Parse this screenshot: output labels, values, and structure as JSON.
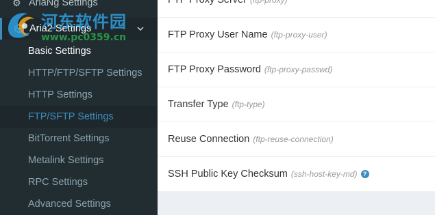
{
  "sidebar": {
    "top_item_label": "AriaNg Settings",
    "aria_item_label": "Aria2 Settings",
    "items": [
      {
        "label": "Basic Settings"
      },
      {
        "label": "HTTP/FTP/SFTP Settings"
      },
      {
        "label": "HTTP Settings"
      },
      {
        "label": "FTP/SFTP Settings"
      },
      {
        "label": "BitTorrent Settings"
      },
      {
        "label": "Metalink Settings"
      },
      {
        "label": "RPC Settings"
      },
      {
        "label": "Advanced Settings"
      }
    ]
  },
  "watermark": {
    "title": "河东软件园",
    "url": "www.pc0359.cn"
  },
  "settings": {
    "rows": [
      {
        "label": "FTP Proxy Server",
        "key": "(ftp-proxy)"
      },
      {
        "label": "FTP Proxy User Name",
        "key": "(ftp-proxy-user)"
      },
      {
        "label": "FTP Proxy Password",
        "key": "(ftp-proxy-passwd)"
      },
      {
        "label": "Transfer Type",
        "key": "(ftp-type)"
      },
      {
        "label": "Reuse Connection",
        "key": "(ftp-reuse-connection)"
      },
      {
        "label": "SSH Public Key Checksum",
        "key": "(ssh-host-key-md)"
      }
    ],
    "help_icon_glyph": "?"
  },
  "colors": {
    "sidebar_bg": "#222d32",
    "active_bg": "#1e282c",
    "accent": "#3c8dbc"
  }
}
